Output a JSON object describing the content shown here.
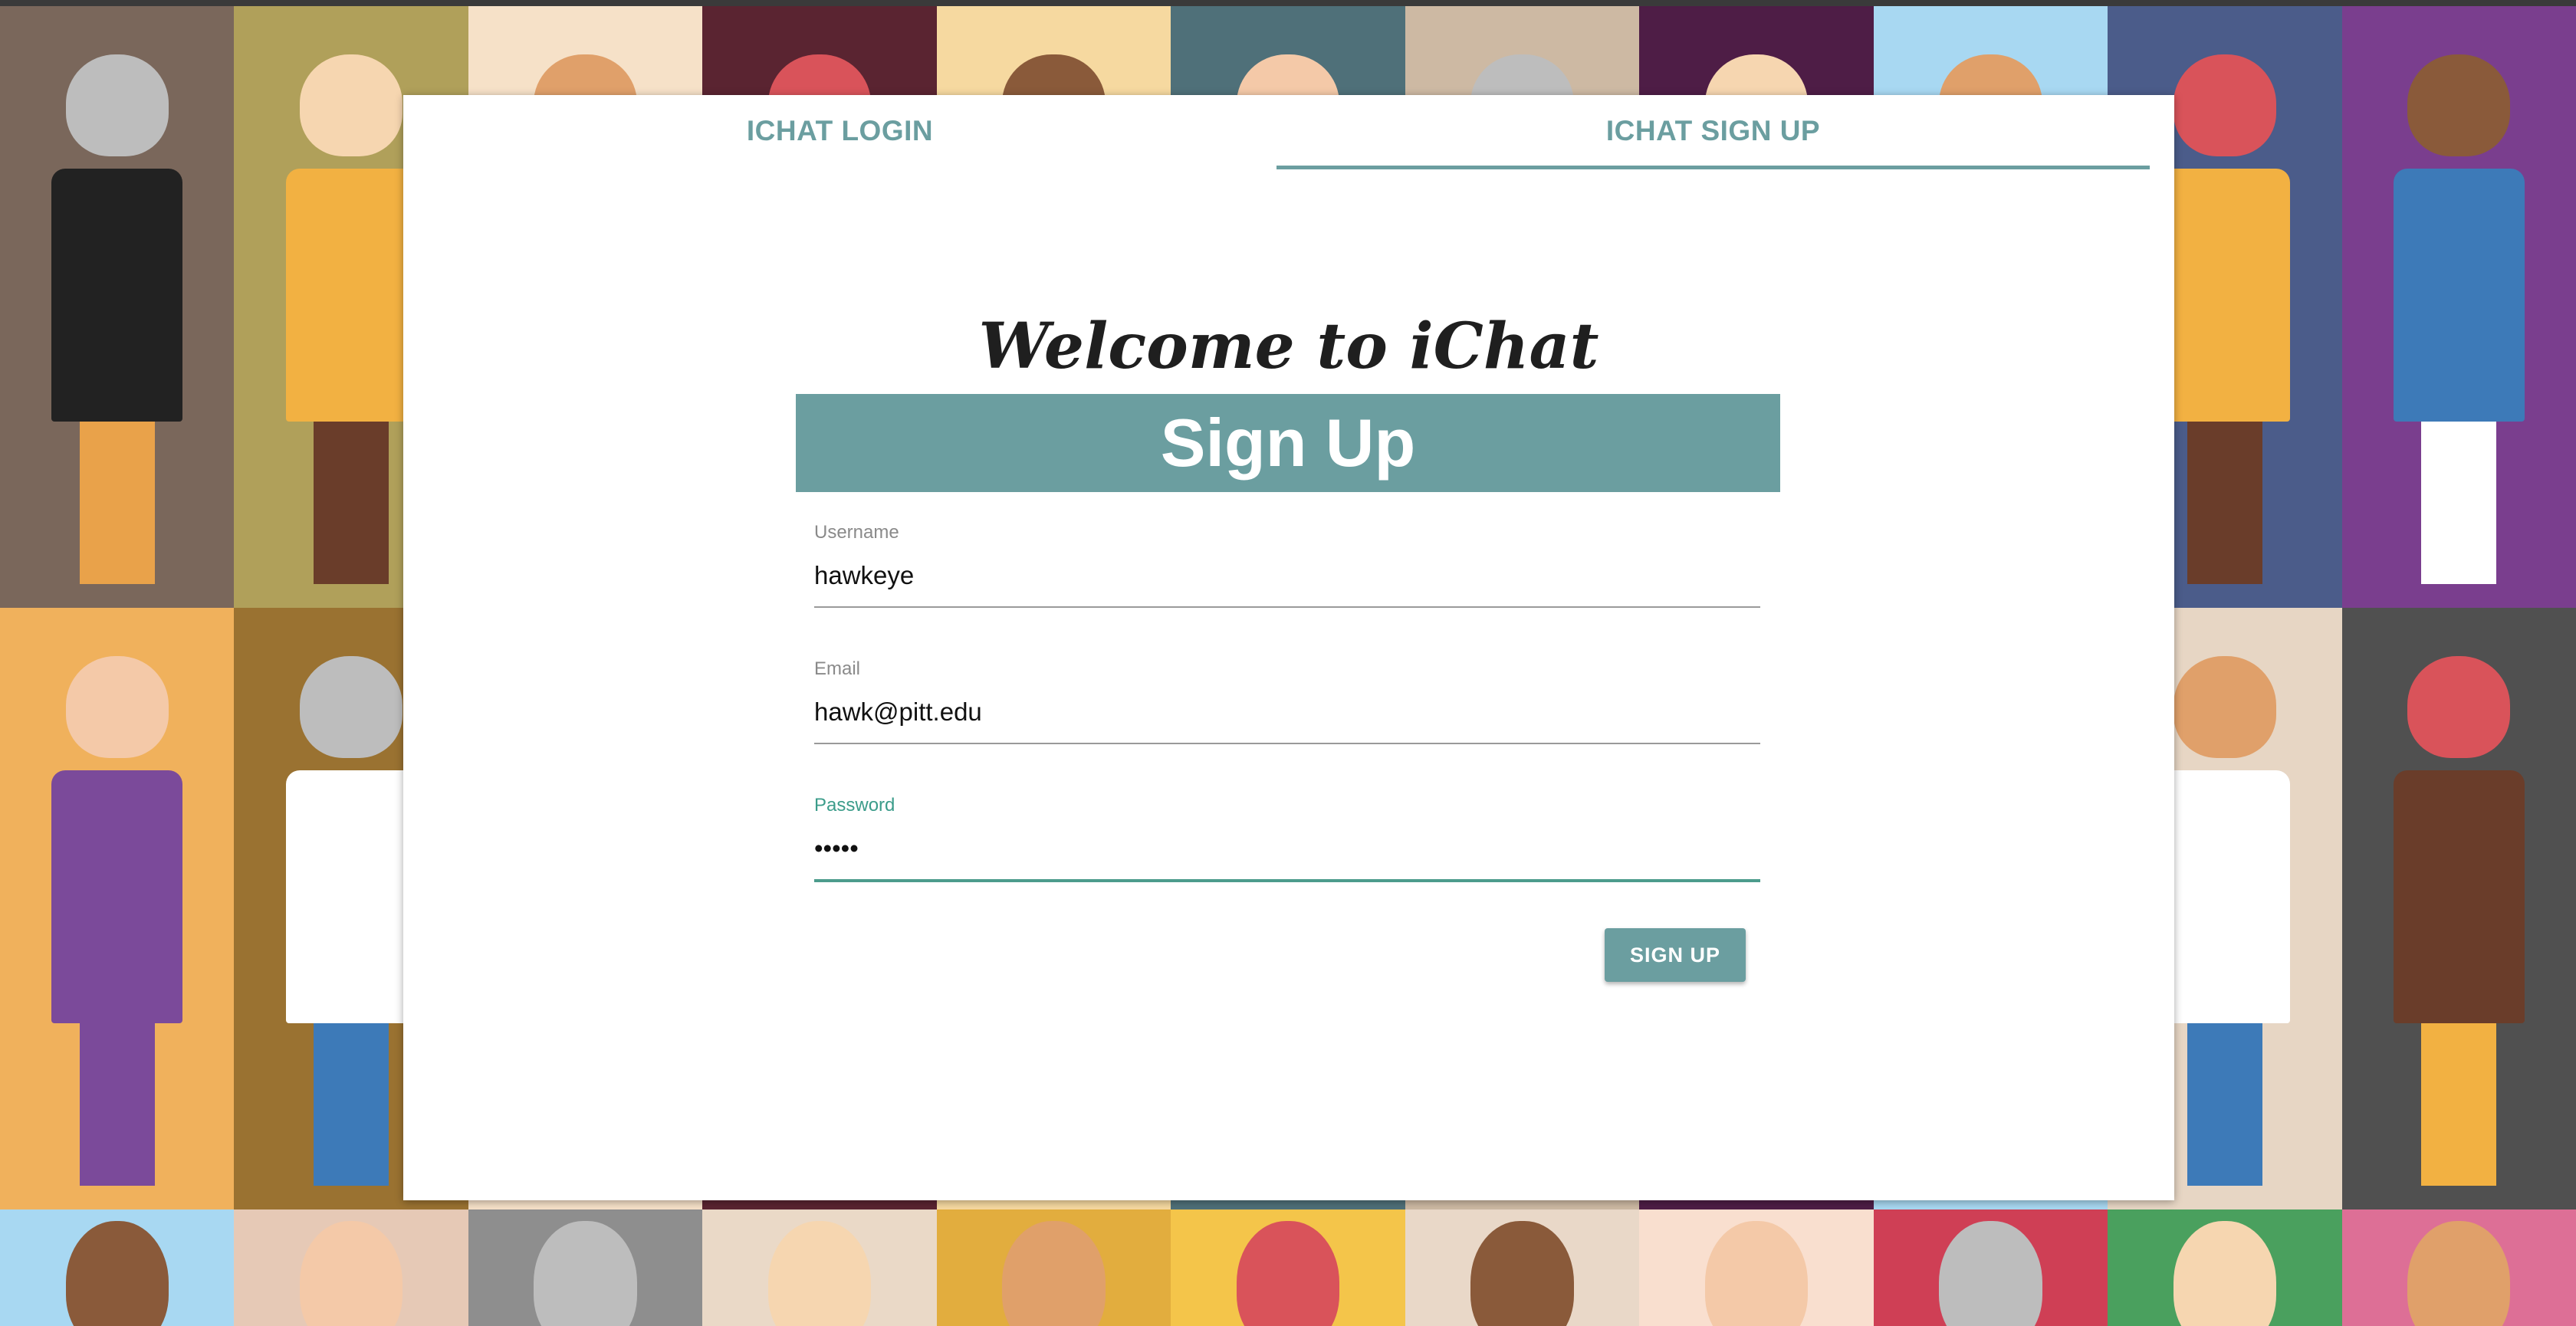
{
  "tabs": {
    "login_label": "ICHAT LOGIN",
    "signup_label": "ICHAT SIGN UP",
    "active": "signup"
  },
  "welcome_text": "Welcome to iChat",
  "form": {
    "title": "Sign Up",
    "username_label": "Username",
    "username_value": "hawkeye",
    "email_label": "Email",
    "email_value": "hawk@pitt.edu",
    "password_label": "Password",
    "password_value": "•••••",
    "submit_label": "SIGN UP"
  },
  "colors": {
    "accent": "#6b9ea0",
    "active_field": "#4c9c8c"
  },
  "background": {
    "tile_colors": [
      "#7a675b",
      "#b0a05a",
      "#f6e1c8",
      "#5a2431",
      "#f6d9a0",
      "#4f7079",
      "#cdb9a3",
      "#4e1d46",
      "#a8d8f2",
      "#4b5c8a",
      "#7a3e8e",
      "#f0b15c",
      "#9a7231",
      "#f6e1c8",
      "#5a2431",
      "#f6d9a0",
      "#4f7079",
      "#cdb9a3",
      "#4e1d46",
      "#a8d8f2",
      "#e7d6c4",
      "#505050",
      "#a8d8f2",
      "#e6c9b6",
      "#8e8e8e",
      "#ead9c7",
      "#e2ad3e",
      "#f4c54a",
      "#e9d8c8",
      "#f9dfcf",
      "#cf3f55",
      "#4aa05e",
      "#dd6f96"
    ]
  }
}
